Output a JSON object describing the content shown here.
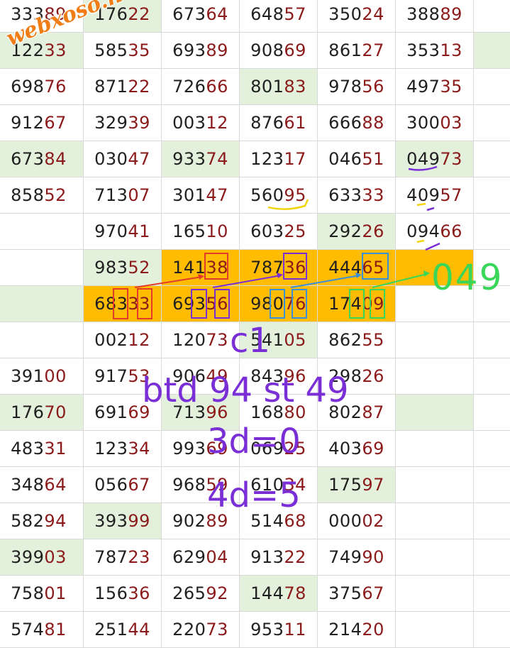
{
  "watermark": "webxoso.net",
  "rows": [
    [
      {
        "v": "33389"
      },
      {
        "v": "17622",
        "g": 1
      },
      {
        "v": "67364"
      },
      {
        "v": "64857"
      },
      {
        "v": "35024"
      },
      {
        "v": "38889"
      },
      {
        "v": ""
      }
    ],
    [
      {
        "v": "12233",
        "g": 1
      },
      {
        "v": "58535"
      },
      {
        "v": "69389"
      },
      {
        "v": "90869"
      },
      {
        "v": "86127"
      },
      {
        "v": "35313"
      },
      {
        "v": "",
        "g": 1
      }
    ],
    [
      {
        "v": "69876"
      },
      {
        "v": "87122"
      },
      {
        "v": "72666"
      },
      {
        "v": "80183",
        "g": 1
      },
      {
        "v": "97856"
      },
      {
        "v": "49735"
      },
      {
        "v": ""
      }
    ],
    [
      {
        "v": "91267"
      },
      {
        "v": "32939"
      },
      {
        "v": "00312"
      },
      {
        "v": "87661"
      },
      {
        "v": "66688"
      },
      {
        "v": "30003"
      },
      {
        "v": ""
      }
    ],
    [
      {
        "v": "67384",
        "g": 1
      },
      {
        "v": "03047"
      },
      {
        "v": "93374",
        "g": 1
      },
      {
        "v": "12317"
      },
      {
        "v": "04651"
      },
      {
        "v": "04973",
        "g": 1
      },
      {
        "v": ""
      }
    ],
    [
      {
        "v": "85852"
      },
      {
        "v": "71307"
      },
      {
        "v": "30147"
      },
      {
        "v": "56095"
      },
      {
        "v": "63333"
      },
      {
        "v": "40957"
      },
      {
        "v": ""
      }
    ],
    [
      {
        "v": ""
      },
      {
        "v": "97041"
      },
      {
        "v": "16510"
      },
      {
        "v": "60325"
      },
      {
        "v": "29226",
        "g": 1
      },
      {
        "v": "09466"
      },
      {
        "v": ""
      }
    ],
    [
      {
        "v": ""
      },
      {
        "v": "98352",
        "g": 1
      },
      {
        "v": "14138",
        "o": 1
      },
      {
        "v": "78736",
        "o": 1
      },
      {
        "v": "44465",
        "o": 1
      },
      {
        "v": "",
        "o": 1
      },
      {
        "v": ""
      }
    ],
    [
      {
        "v": "",
        "g": 1
      },
      {
        "v": "68333",
        "o": 1
      },
      {
        "v": "69356",
        "o": 1
      },
      {
        "v": "98076",
        "o": 1
      },
      {
        "v": "17409",
        "o": 1
      },
      {
        "v": ""
      },
      {
        "v": ""
      }
    ],
    [
      {
        "v": ""
      },
      {
        "v": "00212"
      },
      {
        "v": "12073"
      },
      {
        "v": "54105",
        "g": 1
      },
      {
        "v": "86255"
      },
      {
        "v": ""
      },
      {
        "v": ""
      }
    ],
    [
      {
        "v": "39100"
      },
      {
        "v": "91753"
      },
      {
        "v": "90649"
      },
      {
        "v": "84396"
      },
      {
        "v": "29826"
      },
      {
        "v": ""
      },
      {
        "v": ""
      }
    ],
    [
      {
        "v": "17670",
        "g": 1
      },
      {
        "v": "69169"
      },
      {
        "v": "71396",
        "g": 1
      },
      {
        "v": "16880"
      },
      {
        "v": "80287"
      },
      {
        "v": "",
        "g": 1
      },
      {
        "v": ""
      }
    ],
    [
      {
        "v": "48331"
      },
      {
        "v": "12334"
      },
      {
        "v": "99369"
      },
      {
        "v": "06925"
      },
      {
        "v": "40369"
      },
      {
        "v": ""
      },
      {
        "v": ""
      }
    ],
    [
      {
        "v": "34864"
      },
      {
        "v": "05667"
      },
      {
        "v": "96859"
      },
      {
        "v": "61034"
      },
      {
        "v": "17597",
        "g": 1
      },
      {
        "v": ""
      },
      {
        "v": ""
      }
    ],
    [
      {
        "v": "58294"
      },
      {
        "v": "39399",
        "g": 1
      },
      {
        "v": "90289"
      },
      {
        "v": "51468"
      },
      {
        "v": "00002"
      },
      {
        "v": ""
      },
      {
        "v": ""
      }
    ],
    [
      {
        "v": "39903",
        "g": 1
      },
      {
        "v": "78723"
      },
      {
        "v": "62904"
      },
      {
        "v": "91322"
      },
      {
        "v": "74990"
      },
      {
        "v": ""
      },
      {
        "v": ""
      }
    ],
    [
      {
        "v": "75801"
      },
      {
        "v": "15636"
      },
      {
        "v": "26592"
      },
      {
        "v": "14478",
        "g": 1
      },
      {
        "v": "37567"
      },
      {
        "v": ""
      },
      {
        "v": ""
      }
    ],
    [
      {
        "v": "57481"
      },
      {
        "v": "25144"
      },
      {
        "v": "22073"
      },
      {
        "v": "95311"
      },
      {
        "v": "21420"
      },
      {
        "v": ""
      },
      {
        "v": ""
      }
    ]
  ],
  "handwriting": {
    "line1": "c1",
    "line2": "btd 94 st 49",
    "line3": "3d=0",
    "line4": "4d=5",
    "side": "049"
  },
  "colors": {
    "orange": "#ffbc00",
    "green": "#e3f1dc",
    "purple": "#7a2fd6",
    "red": "#e23b2a",
    "blue": "#3b8fd6",
    "lime": "#3ad65a"
  }
}
